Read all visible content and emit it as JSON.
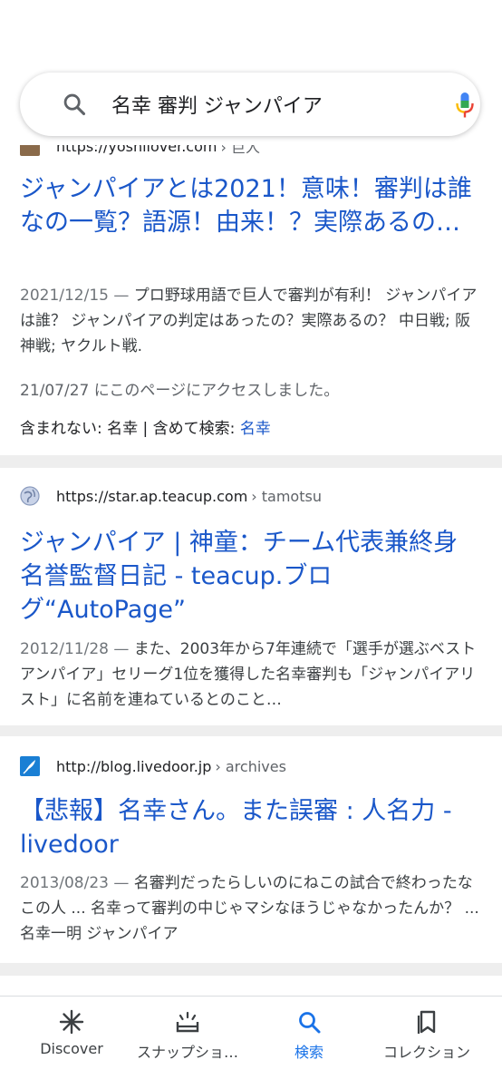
{
  "search": {
    "query": "名幸 審判 ジャンパイア"
  },
  "results": [
    {
      "url": "https://yoshilover.com",
      "path": "› 巨人",
      "title": "ジャンパイアとは2021！意味！審判は誰なの一覧？語源！由来！？実際あるの…",
      "date": "2021/12/15 —",
      "snippet": "プロ野球用語で巨人で審判が有利！ ジャンパイアは誰？ ジャンパイアの判定はあったの？実際あるの？ 中日戦; 阪神戦; ヤクルト戦.",
      "visited": "21/07/27 にこのページにアクセスしました。",
      "missing_label": "含まれない: 名幸 | 含めて検索:",
      "missing_link": "名幸"
    },
    {
      "url": "https://star.ap.teacup.com",
      "path": "› tamotsu",
      "title": "ジャンパイア | 神童：チーム代表兼終身名誉監督日記 - teacup.ブログ“AutoPage”",
      "date": "2012/11/28 —",
      "snippet": "また、2003年から7年連続で「選手が選ぶベストアンパイア」セリーグ1位を獲得した名幸審判も「ジャンパイアリスト」に名前を連ねているとのこと…"
    },
    {
      "url": "http://blog.livedoor.jp",
      "path": "› archives",
      "title": "【悲報】名幸さん。また誤審 : 人名力 - livedoor",
      "date": "2013/08/23 —",
      "snippet": "名審判だったらしいのにねこの試合で終わったなこの人 ... 名幸って審判の中じゃマシなほうじゃなかったんか？ ... 名幸一明 ジャンパイア"
    }
  ],
  "bottom_nav": [
    {
      "label": "Discover",
      "icon": "asterisk-icon",
      "active": false
    },
    {
      "label": "スナップショ…",
      "icon": "snapshot-icon",
      "active": false
    },
    {
      "label": "検索",
      "icon": "search-icon",
      "active": true
    },
    {
      "label": "コレクション",
      "icon": "bookmark-icon",
      "active": false
    }
  ],
  "colors": {
    "link": "#1a57c9",
    "active_nav": "#1a73e8",
    "separator": "#eeeeee"
  }
}
